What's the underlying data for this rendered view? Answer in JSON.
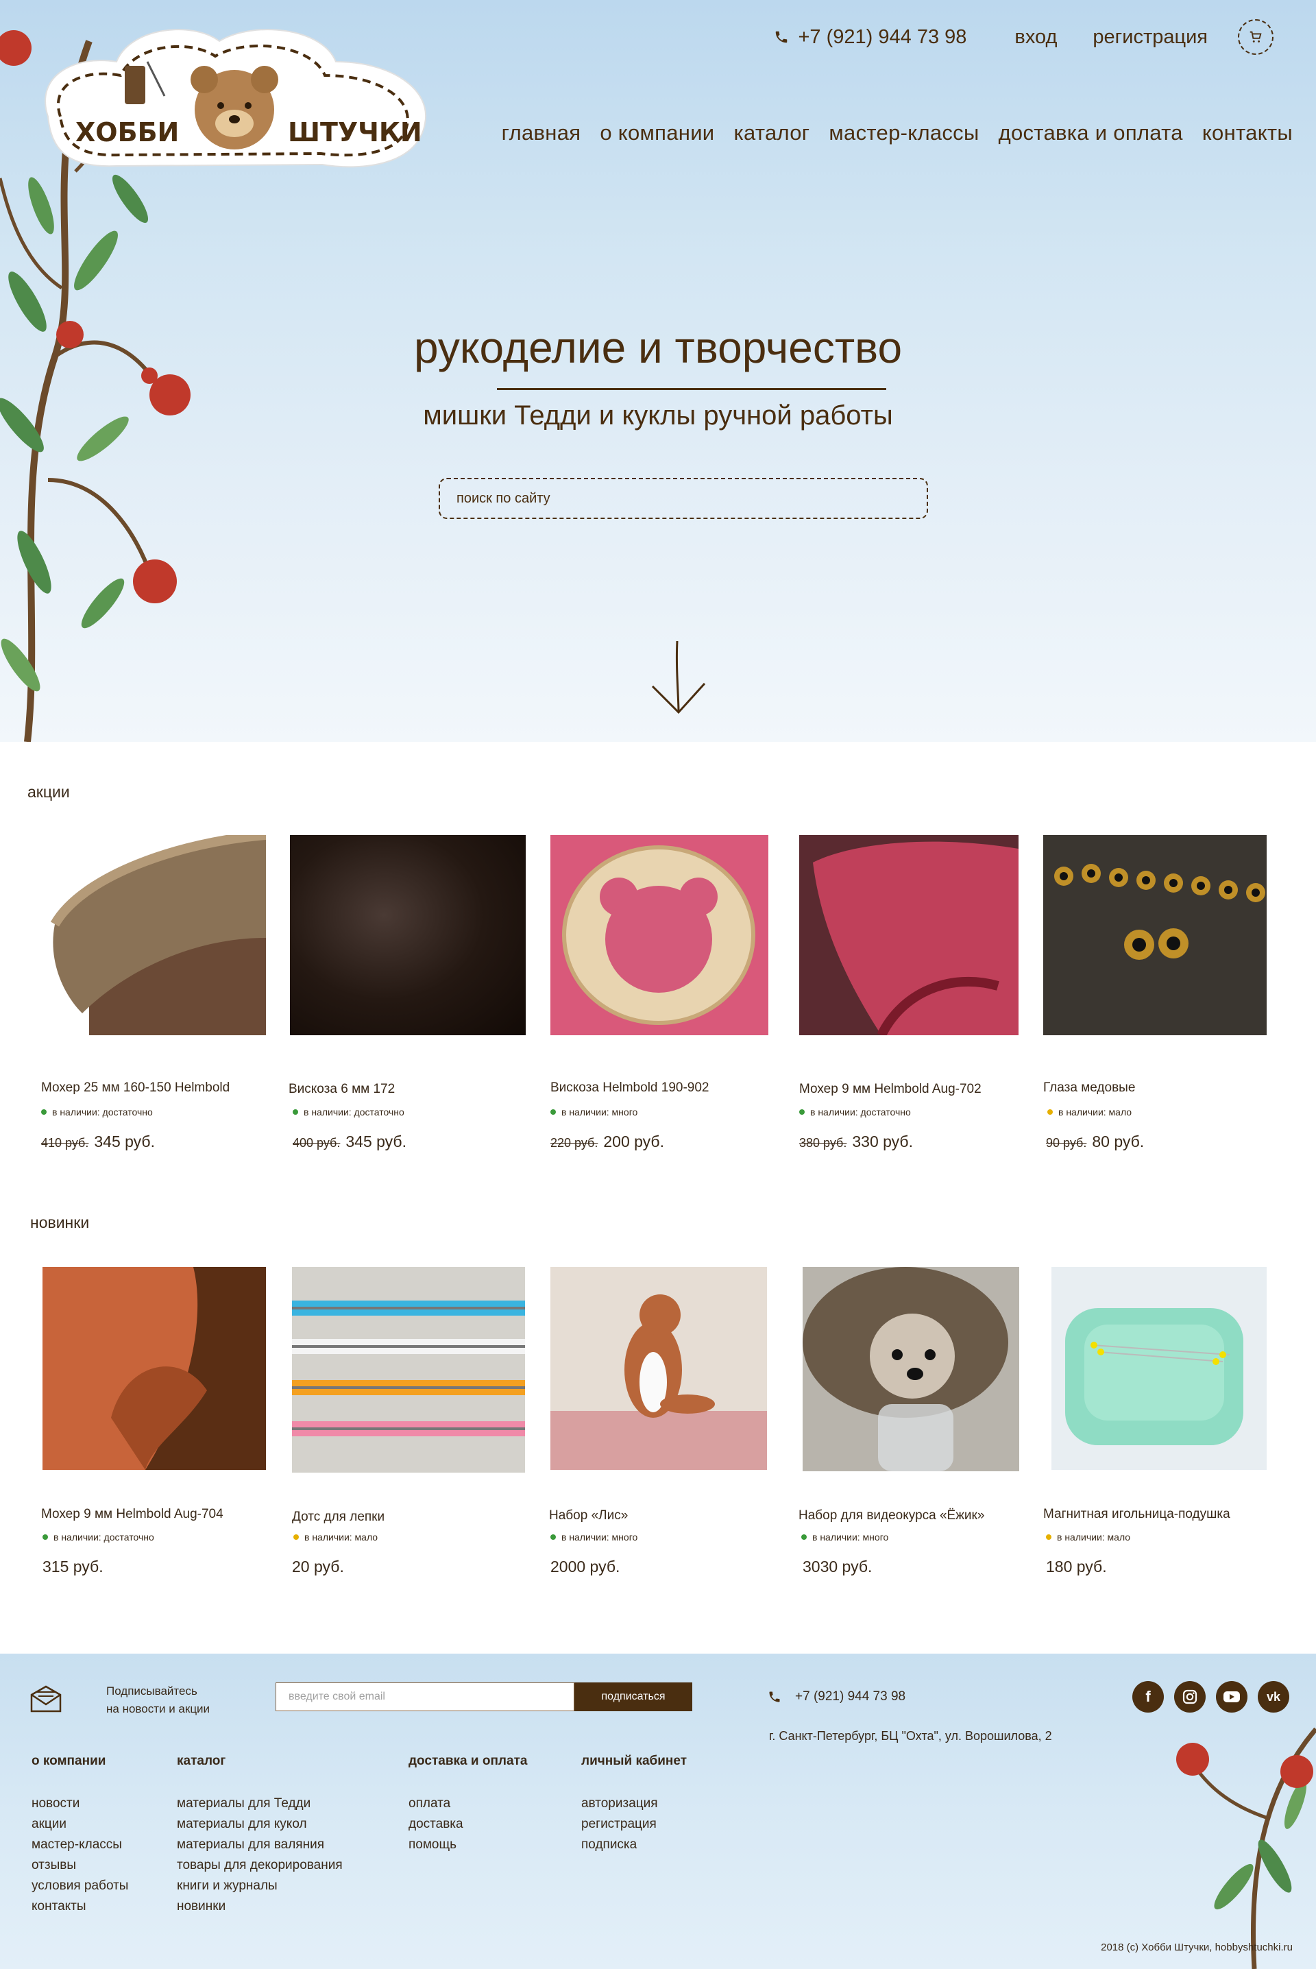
{
  "header": {
    "phone": "+7 (921) 944 73 98",
    "login": "вход",
    "register": "регистрация",
    "logo_word1": "ХОББИ",
    "logo_word2": "ШТУЧКИ"
  },
  "nav": [
    "главная",
    "о компании",
    "каталог",
    "мастер-классы",
    "доставка и оплата",
    "контакты"
  ],
  "hero": {
    "title": "рукоделие и творчество",
    "subtitle": "мишки Тедди и куклы ручной работы",
    "search_placeholder": "поиск по сайту"
  },
  "sale": {
    "title": "акции",
    "items": [
      {
        "name": "Мохер 25 мм 160-150 Helmbold",
        "stock": "в наличии: достаточно",
        "stock_color": "#3a9a3a",
        "old_price": "410 руб.",
        "price": "345 руб."
      },
      {
        "name": "Вискоза 6 мм 172",
        "stock": "в наличии: достаточно",
        "stock_color": "#3a9a3a",
        "old_price": "400 руб.",
        "price": "345 руб."
      },
      {
        "name": "Вискоза Helmbold 190-902",
        "stock": "в наличии: много",
        "stock_color": "#3a9a3a",
        "old_price": "220 руб.",
        "price": "200 руб."
      },
      {
        "name": "Мохер 9 мм Helmbold Aug-702",
        "stock": "в наличии: достаточно",
        "stock_color": "#3a9a3a",
        "old_price": "380 руб.",
        "price": "330 руб."
      },
      {
        "name": "Глаза медовые",
        "stock": "в наличии: мало",
        "stock_color": "#e6b000",
        "old_price": "90 руб.",
        "price": "80 руб."
      }
    ]
  },
  "new": {
    "title": "новинки",
    "items": [
      {
        "name": "Мохер 9 мм Helmbold Aug-704",
        "stock": "в наличии: достаточно",
        "stock_color": "#3a9a3a",
        "price": "315 руб."
      },
      {
        "name": "Дотс для лепки",
        "stock": "в наличии: мало",
        "stock_color": "#e6b000",
        "price": "20 руб."
      },
      {
        "name": "Набор «Лис»",
        "stock": "в наличии: много",
        "stock_color": "#3a9a3a",
        "price": "2000 руб."
      },
      {
        "name": "Набор для видеокурса «Ёжик»",
        "stock": "в наличии: много",
        "stock_color": "#3a9a3a",
        "price": "3030 руб."
      },
      {
        "name": "Магнитная игольница-подушка",
        "stock": "в наличии: мало",
        "stock_color": "#e6b000",
        "price": "180 руб."
      }
    ]
  },
  "footer": {
    "subscribe_line1": "Подписывайтесь",
    "subscribe_line2": "на новости и акции",
    "email_placeholder": "введите свой email",
    "subscribe_button": "подписаться",
    "phone": "+7 (921) 944 73 98",
    "address": "г. Санкт-Петербург, БЦ \"Охта\", ул. Ворошилова, 2",
    "socials": [
      "facebook-icon",
      "instagram-icon",
      "youtube-icon",
      "vk-icon"
    ],
    "columns": [
      {
        "title": "о компании",
        "items": [
          "новости",
          "акции",
          "мастер-классы",
          "отзывы",
          "условия работы",
          "контакты"
        ]
      },
      {
        "title": "каталог",
        "items": [
          "материалы для Тедди",
          "материалы для кукол",
          "материалы для валяния",
          "товары для декорирования",
          "книги и журналы",
          "новинки"
        ]
      },
      {
        "title": "доставка и оплата",
        "items": [
          "оплата",
          "доставка",
          "помощь"
        ]
      },
      {
        "title": "личный кабинет",
        "items": [
          "авторизация",
          "регистрация",
          "подписка"
        ]
      }
    ],
    "copyright": "2018 (c) Хобби Штучки, hobbyshtuchki.ru"
  },
  "colors": {
    "brand": "#4a2e10",
    "in_stock": "#3a9a3a",
    "low_stock": "#e6b000"
  }
}
